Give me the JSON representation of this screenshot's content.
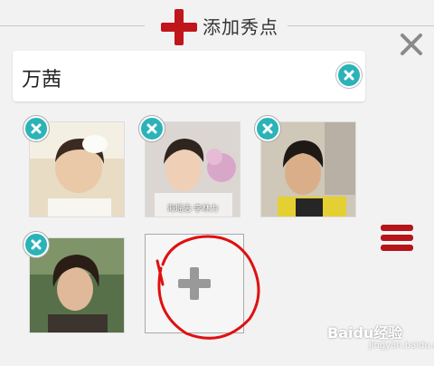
{
  "header": {
    "title": "添加秀点",
    "close_icon": "close-icon",
    "add_icon": "plus-icon",
    "accent": "#c0151b"
  },
  "name_field": {
    "value": "万茜",
    "clear_icon": "clear-icon"
  },
  "photos": [
    {
      "caption": ""
    },
    {
      "caption": "海瑶志·李林力"
    },
    {
      "caption": ""
    },
    {
      "caption": ""
    }
  ],
  "add_photo": {
    "icon": "plus-icon"
  },
  "menu": {
    "icon": "hamburger-menu-icon"
  },
  "watermark": {
    "text": "Baidu经验",
    "sub": "jingyan.baidu.com"
  },
  "colors": {
    "remove_badge": "#2bb3b8",
    "menu": "#b5141a",
    "annotation": "#e01010"
  }
}
